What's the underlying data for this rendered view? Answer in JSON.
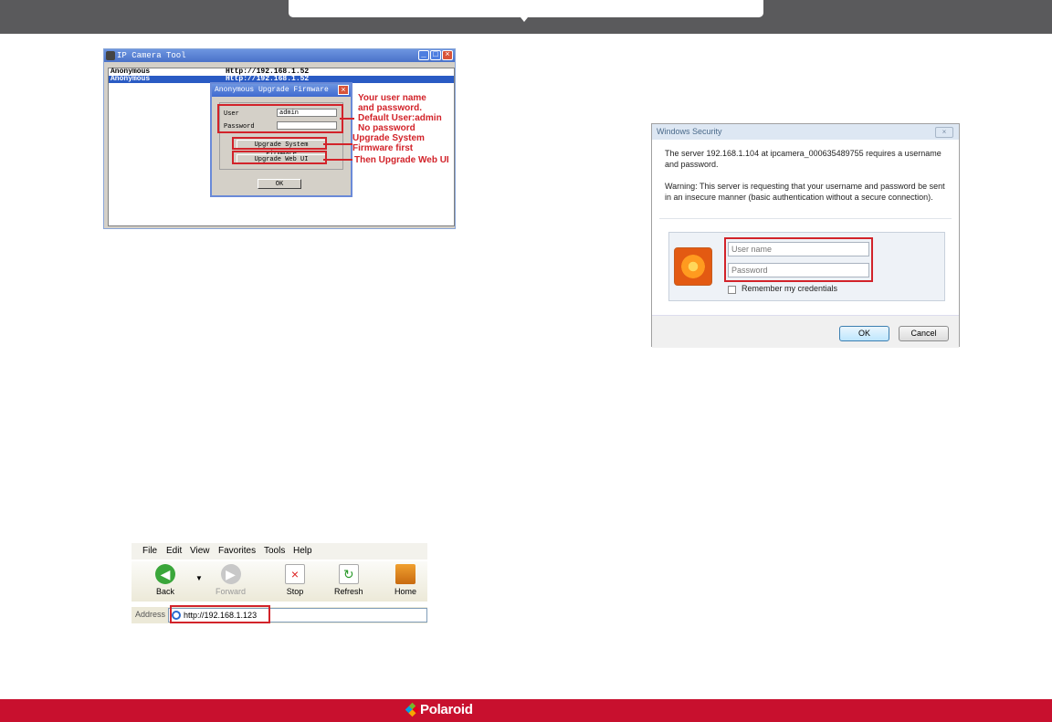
{
  "ip_tool": {
    "title": "IP Camera Tool",
    "rows": [
      {
        "name": "Anonymous",
        "url": "Http://192.168.1.52"
      },
      {
        "name": "Anonymous",
        "url": "Http://192.168.1.52"
      }
    ],
    "dialog": {
      "title": "Anonymous Upgrade Firmware",
      "user_label": "User",
      "user_value": "admin",
      "password_label": "Password",
      "password_value": "",
      "upgrade_system_label": "Upgrade System Firmware",
      "upgrade_web_label": "Upgrade Web UI",
      "ok_label": "OK"
    },
    "annotations": {
      "credentials_line1": "Your user name",
      "credentials_line2": "and password.",
      "credentials_line3": "Default User:admin",
      "credentials_line4": "No password",
      "system_line1": "Upgrade System",
      "system_line2": "Firmware first",
      "web": "Then Upgrade Web UI"
    }
  },
  "win_security": {
    "title": "Windows Security",
    "message": "The server 192.168.1.104 at ipcamera_000635489755 requires a username and password.",
    "warning": "Warning: This server is requesting that your username and password be sent in an insecure manner (basic authentication without a secure connection).",
    "username_placeholder": "User name",
    "password_placeholder": "Password",
    "remember_label": "Remember my credentials",
    "ok_label": "OK",
    "cancel_label": "Cancel"
  },
  "browser": {
    "menu": [
      "File",
      "Edit",
      "View",
      "Favorites",
      "Tools",
      "Help"
    ],
    "buttons": {
      "back": "Back",
      "forward": "Forward",
      "stop": "Stop",
      "refresh": "Refresh",
      "home": "Home"
    },
    "address_label": "Address",
    "address_value": "http://192.168.1.123"
  },
  "footer": {
    "brand": "Polaroid"
  },
  "colors": {
    "header": "#5a5a5c",
    "footer": "#c8102e",
    "annotation_red": "#d2232a"
  }
}
